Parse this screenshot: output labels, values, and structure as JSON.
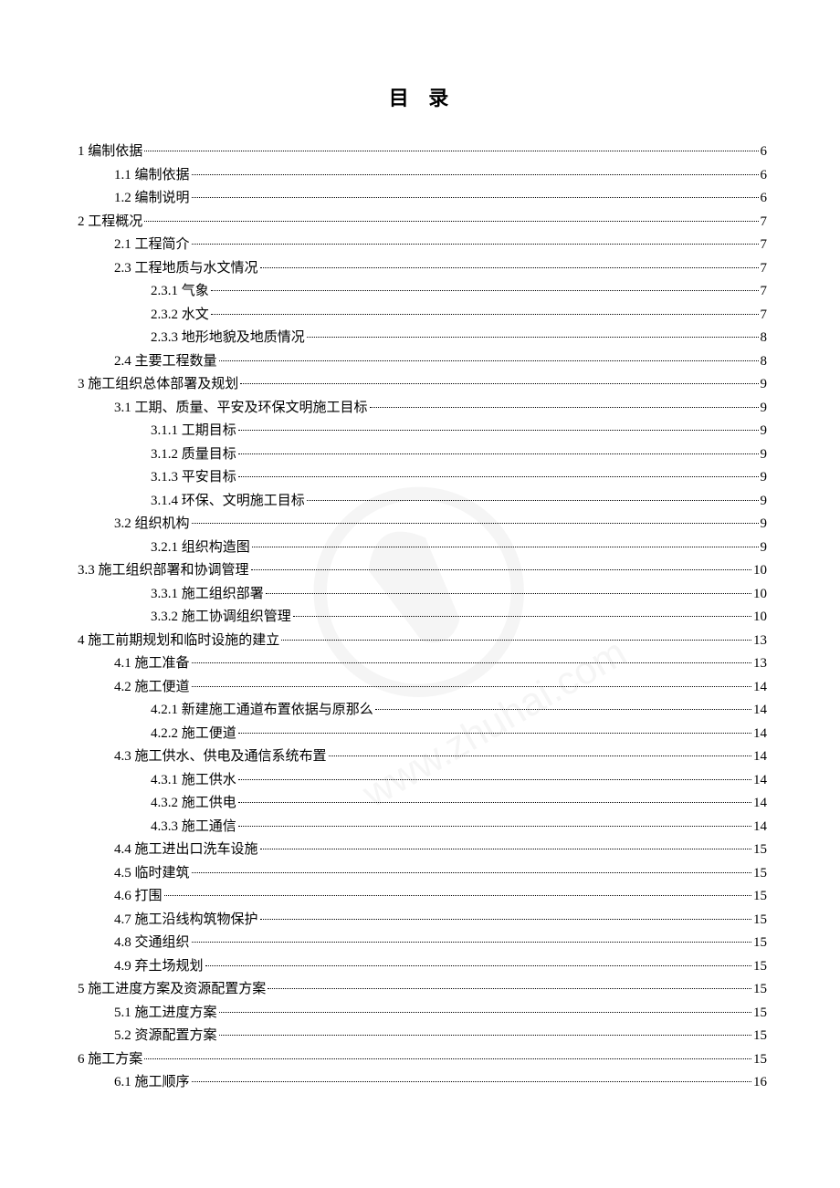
{
  "title": "目  录",
  "entries": [
    {
      "level": 0,
      "text": "1 编制依据",
      "page": "6"
    },
    {
      "level": 1,
      "text": "1.1 编制依据",
      "page": "6"
    },
    {
      "level": 1,
      "text": "1.2 编制说明",
      "page": "6"
    },
    {
      "level": 0,
      "text": "2 工程概况",
      "page": "7"
    },
    {
      "level": 1,
      "text": "2.1 工程简介",
      "page": "7"
    },
    {
      "level": 1,
      "text": "2.3 工程地质与水文情况",
      "page": "7"
    },
    {
      "level": 2,
      "text": "2.3.1 气象",
      "page": "7"
    },
    {
      "level": 2,
      "text": "2.3.2 水文",
      "page": "7"
    },
    {
      "level": 2,
      "text": "2.3.3 地形地貌及地质情况",
      "page": "8"
    },
    {
      "level": 1,
      "text": "2.4 主要工程数量",
      "page": "8"
    },
    {
      "level": 0,
      "text": "3  施工组织总体部署及规划",
      "page": "9"
    },
    {
      "level": 1,
      "text": "3.1 工期、质量、平安及环保文明施工目标",
      "page": "9"
    },
    {
      "level": 2,
      "text": "3.1.1 工期目标",
      "page": "9"
    },
    {
      "level": 2,
      "text": "3.1.2 质量目标",
      "page": "9"
    },
    {
      "level": 2,
      "text": "3.1.3 平安目标",
      "page": "9"
    },
    {
      "level": 2,
      "text": "3.1.4 环保、文明施工目标",
      "page": "9"
    },
    {
      "level": 1,
      "text": "3.2 组织机构",
      "page": "9"
    },
    {
      "level": 2,
      "text": "3.2.1 组织构造图",
      "page": "9"
    },
    {
      "level": 0,
      "text": "3.3  施工组织部署和协调管理",
      "page": "10"
    },
    {
      "level": 2,
      "text": "3.3.1 施工组织部署",
      "page": "10"
    },
    {
      "level": 2,
      "text": "3.3.2  施工协调组织管理",
      "page": "10"
    },
    {
      "level": 0,
      "text": "4 施工前期规划和临时设施的建立",
      "page": "13"
    },
    {
      "level": 1,
      "text": "4.1 施工准备",
      "page": "13"
    },
    {
      "level": 1,
      "text": "4.2 施工便道",
      "page": "14"
    },
    {
      "level": 2,
      "text": "4.2.1 新建施工通道布置依据与原那么",
      "page": "14"
    },
    {
      "level": 2,
      "text": "4.2.2 施工便道",
      "page": "14"
    },
    {
      "level": 1,
      "text": "4.3 施工供水、供电及通信系统布置",
      "page": "14"
    },
    {
      "level": 2,
      "text": "4.3.1 施工供水",
      "page": "14"
    },
    {
      "level": 2,
      "text": "4.3.2 施工供电",
      "page": "14"
    },
    {
      "level": 2,
      "text": "4.3.3 施工通信",
      "page": "14"
    },
    {
      "level": 1,
      "text": "4.4 施工进出口洗车设施",
      "page": "15"
    },
    {
      "level": 1,
      "text": "4.5 临时建筑",
      "page": "15"
    },
    {
      "level": 1,
      "text": "4.6 打围",
      "page": "15"
    },
    {
      "level": 1,
      "text": "4.7 施工沿线构筑物保护",
      "page": "15"
    },
    {
      "level": 1,
      "text": "4.8 交通组织",
      "page": "15"
    },
    {
      "level": 1,
      "text": "4.9 弃土场规划",
      "page": "15"
    },
    {
      "level": 0,
      "text": "5 施工进度方案及资源配置方案",
      "page": "15"
    },
    {
      "level": 1,
      "text": "5.1 施工进度方案",
      "page": "15"
    },
    {
      "level": 1,
      "text": "5.2 资源配置方案",
      "page": "15"
    },
    {
      "level": 0,
      "text": "6 施工方案",
      "page": "15"
    },
    {
      "level": 1,
      "text": "6.1 施工顺序",
      "page": "16"
    }
  ]
}
